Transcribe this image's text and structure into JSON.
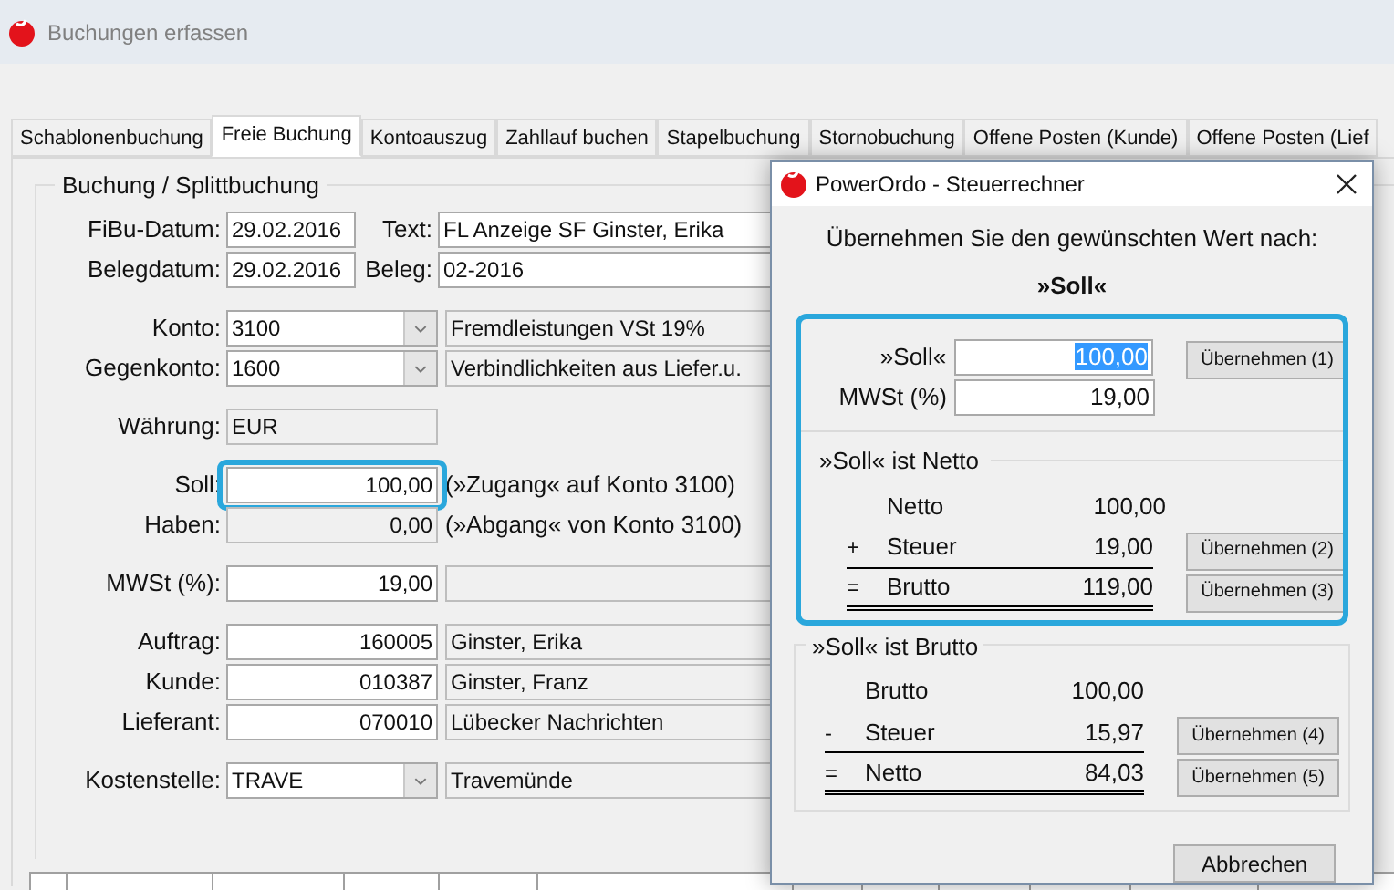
{
  "window": {
    "title": "Buchungen erfassen"
  },
  "tabs": [
    {
      "label": "Schablonenbuchung",
      "selected": false
    },
    {
      "label": "Freie Buchung",
      "selected": true
    },
    {
      "label": "Kontoauszug",
      "selected": false
    },
    {
      "label": "Zahllauf buchen",
      "selected": false
    },
    {
      "label": "Stapelbuchung",
      "selected": false
    },
    {
      "label": "Stornobuchung",
      "selected": false
    },
    {
      "label": "Offene Posten (Kunde)",
      "selected": false
    },
    {
      "label": "Offene Posten (Lief",
      "selected": false
    }
  ],
  "group": {
    "title": "Buchung / Splittbuchung"
  },
  "sections": [
    [
      {
        "label": "FiBu-Datum:",
        "value": "29.02.2016",
        "kind": "date",
        "side": {
          "kind": "labeled_field",
          "label": "Text:",
          "value": "FL Anzeige SF Ginster, Erika"
        }
      },
      {
        "label": "Belegdatum:",
        "value": "29.02.2016",
        "kind": "date",
        "side": {
          "kind": "labeled_field",
          "label": "Beleg:",
          "value": "02-2016"
        }
      }
    ],
    [
      {
        "label": "Konto:",
        "value": "3100",
        "kind": "combo",
        "side": {
          "kind": "field",
          "value": "Fremdleistungen VSt 19%"
        }
      },
      {
        "label": "Gegenkonto:",
        "value": "1600",
        "kind": "combo",
        "side": {
          "kind": "field",
          "value": "Verbindlichkeiten aus Liefer.u."
        }
      }
    ],
    [
      {
        "label": "Währung:",
        "value": "EUR",
        "kind": "readonly"
      }
    ],
    [
      {
        "label": "Soll:",
        "value": "100,00",
        "kind": "amount",
        "highlighted": true,
        "side": {
          "kind": "note",
          "value": "(»Zugang« auf Konto 3100)"
        }
      },
      {
        "label": "Haben:",
        "value": "0,00",
        "kind": "amount_readonly",
        "side": {
          "kind": "note",
          "value": "(»Abgang« von Konto 3100)"
        }
      }
    ],
    [
      {
        "label": "MWSt (%):",
        "value": "19,00",
        "kind": "amount",
        "side": {
          "kind": "field"
        }
      }
    ],
    [
      {
        "label": "Auftrag:",
        "value": "160005",
        "kind": "amount",
        "side": {
          "kind": "field",
          "value": "Ginster, Erika"
        }
      },
      {
        "label": "Kunde:",
        "value": "010387",
        "kind": "amount",
        "side": {
          "kind": "field",
          "value": "Ginster, Franz"
        }
      },
      {
        "label": "Lieferant:",
        "value": "070010",
        "kind": "amount",
        "side": {
          "kind": "field",
          "value": "Lübecker Nachrichten"
        }
      }
    ],
    [
      {
        "label": "Kostenstelle:",
        "value": "TRAVE",
        "kind": "combo",
        "side": {
          "kind": "field",
          "value": "Travemünde"
        }
      }
    ]
  ],
  "dialog": {
    "title": "PowerOrdo - Steuerrechner",
    "prompt": "Übernehmen Sie den gewünschten Wert nach:",
    "target": "»Soll«",
    "top_highlighted": true,
    "inputs": [
      {
        "label": "»Soll«",
        "value": "100,00",
        "selected": true,
        "button": "Übernehmen (1)"
      },
      {
        "label": "MWSt (%)",
        "value": "19,00",
        "selected": false
      }
    ],
    "groups": [
      {
        "title": "»Soll« ist Netto",
        "lines": [
          {
            "label": "Netto",
            "value": "100,00"
          },
          {
            "op": "+",
            "label": "Steuer",
            "value": "19,00",
            "button": "Übernehmen (2)"
          },
          {
            "op": "=",
            "label": "Brutto",
            "value": "119,00",
            "button": "Übernehmen (3)"
          }
        ]
      },
      {
        "title": "»Soll« ist Brutto",
        "lines": [
          {
            "label": "Brutto",
            "value": "100,00"
          },
          {
            "op": "-",
            "label": "Steuer",
            "value": "15,97",
            "button": "Übernehmen (4)"
          },
          {
            "op": "=",
            "label": "Netto",
            "value": "84,03",
            "button": "Übernehmen (5)"
          }
        ]
      }
    ],
    "cancel": "Abbrechen"
  }
}
